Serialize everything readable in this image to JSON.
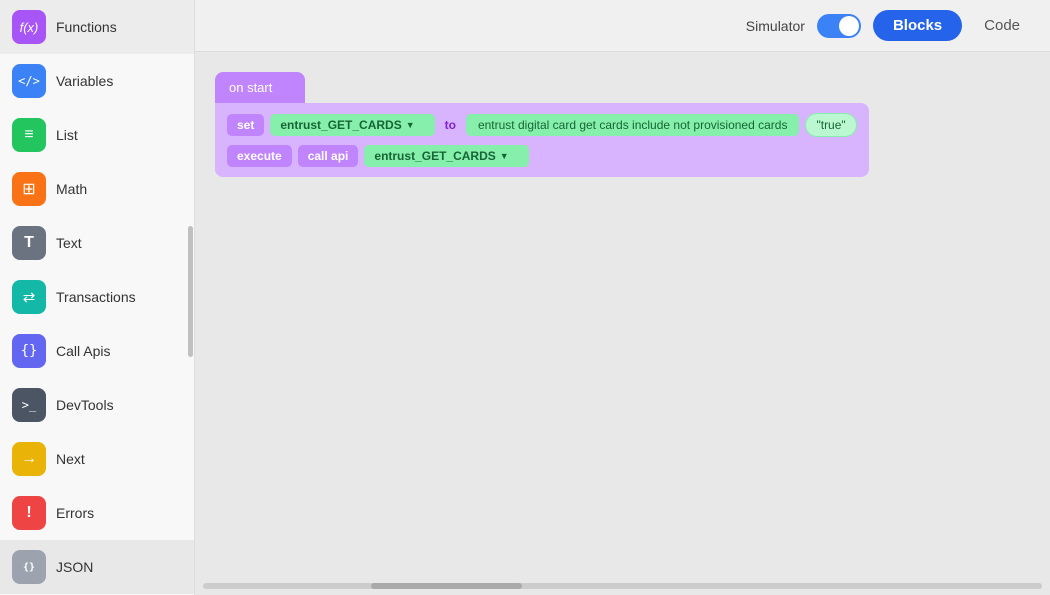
{
  "sidebar": {
    "items": [
      {
        "id": "functions",
        "label": "Functions",
        "icon": "f(x)",
        "iconClass": "icon-purple",
        "active": false
      },
      {
        "id": "variables",
        "label": "Variables",
        "icon": "</>",
        "iconClass": "icon-blue",
        "active": false
      },
      {
        "id": "list",
        "label": "List",
        "icon": "≡",
        "iconClass": "icon-green",
        "active": false
      },
      {
        "id": "math",
        "label": "Math",
        "icon": "⊞",
        "iconClass": "icon-orange",
        "active": false
      },
      {
        "id": "text",
        "label": "Text",
        "icon": "T",
        "iconClass": "icon-gray-t",
        "active": false
      },
      {
        "id": "transactions",
        "label": "Transactions",
        "icon": "⇄",
        "iconClass": "icon-teal",
        "active": false
      },
      {
        "id": "call-apis",
        "label": "Call Apis",
        "icon": "{}",
        "iconClass": "icon-curly",
        "active": false
      },
      {
        "id": "devtools",
        "label": "DevTools",
        "icon": ">_",
        "iconClass": "icon-devtools",
        "active": false
      },
      {
        "id": "next",
        "label": "Next",
        "icon": "→",
        "iconClass": "icon-yellow",
        "active": false
      },
      {
        "id": "errors",
        "label": "Errors",
        "icon": "!",
        "iconClass": "icon-red",
        "active": false
      },
      {
        "id": "json",
        "label": "JSON",
        "icon": "",
        "iconClass": "icon-gray",
        "active": true
      }
    ]
  },
  "topbar": {
    "simulator_label": "Simulator",
    "blocks_button": "Blocks",
    "code_button": "Code"
  },
  "canvas": {
    "on_start_label": "on start",
    "set_keyword": "set",
    "to_keyword": "to",
    "execute_keyword": "execute",
    "call_keyword": "call api",
    "dropdown1": "entrust_GET_CARDS",
    "dropdown2": "entrust_GET_CARDS",
    "description": "entrust digital card get cards include not provisioned cards",
    "string_value": "\"true\""
  }
}
